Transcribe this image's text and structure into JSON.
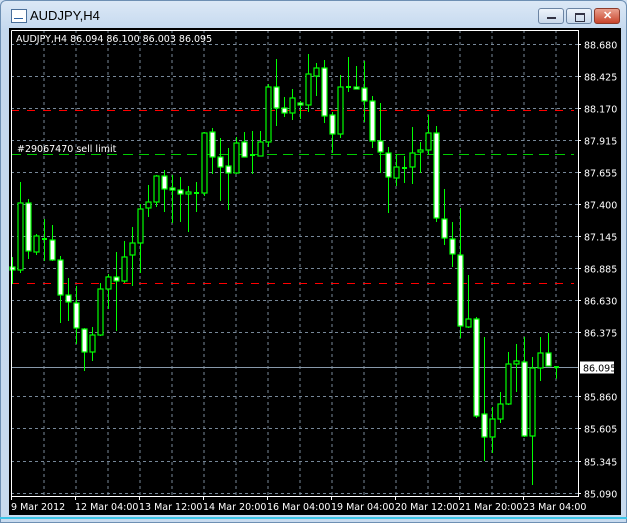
{
  "window": {
    "title": "AUDJPY,H4",
    "minimize_icon": "minimize-icon",
    "maximize_icon": "restore-icon",
    "close_icon": "close-icon"
  },
  "chart_header": "AUDJPY,H4  86.094 86.100 86.003 86.095",
  "order_label": "#29067470 sell limit",
  "colors": {
    "background": "#000000",
    "candle": "#00ff00",
    "bear_fill": "#ffffff",
    "bull_fill": "#000000",
    "grid": "#778899",
    "level_line": "#ff0000",
    "order_line": "#00cc00",
    "price_line": "#8899aa"
  },
  "chart_data": {
    "type": "candlestick",
    "symbol": "AUDJPY",
    "timeframe": "H4",
    "ylim": [
      85.064,
      88.792
    ],
    "grid": true,
    "price_ticks": [
      "88.680",
      "88.425",
      "88.170",
      "87.915",
      "87.655",
      "87.400",
      "87.145",
      "86.885",
      "86.630",
      "86.375",
      "85.860",
      "85.605",
      "85.345",
      "85.090"
    ],
    "current_price": "86.095",
    "date_labels": [
      "9 Mar 2012",
      "12 Mar 04:00",
      "13 Mar 12:00",
      "14 Mar 20:00",
      "16 Mar 04:00",
      "19 Mar 04:00",
      "20 Mar 12:00",
      "21 Mar 20:00",
      "23 Mar 04:00"
    ],
    "levels": [
      {
        "price": 88.152,
        "style": "red-dash"
      },
      {
        "price": 86.768,
        "style": "red-dash"
      }
    ],
    "order_line": {
      "price": 87.8,
      "label": "#29067470 sell limit"
    },
    "ohlc": [
      [
        86.896,
        86.976,
        86.76,
        86.872
      ],
      [
        86.872,
        87.576,
        86.848,
        87.408
      ],
      [
        87.408,
        87.44,
        86.96,
        87.024
      ],
      [
        87.016,
        87.16,
        86.992,
        87.144
      ],
      [
        87.12,
        87.28,
        86.944,
        87.112
      ],
      [
        87.112,
        87.232,
        86.944,
        86.952
      ],
      [
        86.952,
        86.984,
        86.448,
        86.672
      ],
      [
        86.672,
        86.808,
        86.464,
        86.616
      ],
      [
        86.608,
        86.744,
        86.28,
        86.408
      ],
      [
        86.4,
        86.408,
        86.064,
        86.216
      ],
      [
        86.216,
        86.416,
        86.144,
        86.352
      ],
      [
        86.352,
        86.768,
        86.344,
        86.72
      ],
      [
        86.72,
        86.84,
        86.56,
        86.816
      ],
      [
        86.816,
        87.016,
        86.384,
        86.784
      ],
      [
        86.784,
        87.104,
        86.768,
        86.976
      ],
      [
        86.992,
        87.216,
        86.744,
        87.088
      ],
      [
        87.088,
        87.4,
        86.848,
        87.36
      ],
      [
        87.368,
        87.552,
        87.296,
        87.416
      ],
      [
        87.416,
        87.632,
        87.376,
        87.624
      ],
      [
        87.624,
        87.672,
        87.336,
        87.52
      ],
      [
        87.528,
        87.632,
        87.248,
        87.512
      ],
      [
        87.512,
        87.616,
        87.256,
        87.48
      ],
      [
        87.48,
        87.544,
        87.176,
        87.496
      ],
      [
        87.488,
        87.576,
        87.336,
        87.488
      ],
      [
        87.488,
        87.976,
        87.464,
        87.968
      ],
      [
        87.976,
        88.008,
        87.64,
        87.776
      ],
      [
        87.776,
        87.928,
        87.424,
        87.696
      ],
      [
        87.704,
        87.848,
        87.352,
        87.648
      ],
      [
        87.648,
        87.936,
        87.64,
        87.888
      ],
      [
        87.896,
        87.976,
        87.776,
        87.776
      ],
      [
        87.792,
        87.984,
        87.64,
        87.784
      ],
      [
        87.784,
        87.984,
        87.784,
        87.896
      ],
      [
        87.896,
        88.36,
        87.856,
        88.336
      ],
      [
        88.336,
        88.56,
        88.024,
        88.168
      ],
      [
        88.168,
        88.256,
        88.096,
        88.128
      ],
      [
        88.128,
        88.32,
        88.072,
        88.248
      ],
      [
        88.208,
        88.224,
        88.08,
        88.192
      ],
      [
        88.192,
        88.6,
        88.136,
        88.44
      ],
      [
        88.424,
        88.528,
        88.264,
        88.488
      ],
      [
        88.488,
        88.552,
        88.048,
        88.104
      ],
      [
        88.112,
        88.136,
        87.808,
        87.96
      ],
      [
        87.96,
        88.432,
        87.928,
        88.336
      ],
      [
        88.336,
        88.576,
        88.296,
        88.336
      ],
      [
        88.336,
        88.504,
        88.32,
        88.32
      ],
      [
        88.328,
        88.544,
        88.056,
        88.224
      ],
      [
        88.224,
        88.264,
        87.848,
        87.904
      ],
      [
        87.904,
        88.208,
        87.648,
        87.816
      ],
      [
        87.808,
        87.856,
        87.328,
        87.616
      ],
      [
        87.608,
        87.792,
        87.544,
        87.696
      ],
      [
        87.688,
        87.784,
        87.568,
        87.688
      ],
      [
        87.696,
        88.016,
        87.56,
        87.808
      ],
      [
        87.816,
        87.896,
        87.648,
        87.832
      ],
      [
        87.832,
        88.112,
        87.8,
        87.968
      ],
      [
        87.968,
        88.024,
        87.256,
        87.288
      ],
      [
        87.28,
        87.52,
        87.072,
        87.128
      ],
      [
        87.12,
        87.256,
        86.896,
        87.0
      ],
      [
        86.992,
        87.368,
        86.328,
        86.424
      ],
      [
        86.416,
        86.832,
        86.408,
        86.48
      ],
      [
        86.48,
        86.496,
        85.688,
        85.704
      ],
      [
        85.72,
        86.336,
        85.344,
        85.536
      ],
      [
        85.536,
        85.776,
        85.408,
        85.68
      ],
      [
        85.68,
        85.896,
        85.648,
        85.8
      ],
      [
        85.8,
        86.216,
        85.792,
        86.12
      ],
      [
        86.12,
        86.28,
        85.896,
        86.144
      ],
      [
        86.136,
        86.336,
        85.536,
        85.544
      ],
      [
        85.544,
        86.176,
        85.152,
        86.088
      ],
      [
        86.088,
        86.336,
        85.984,
        86.208
      ],
      [
        86.208,
        86.368,
        86.104,
        86.104
      ],
      [
        86.094,
        86.1,
        86.003,
        86.095
      ]
    ]
  }
}
